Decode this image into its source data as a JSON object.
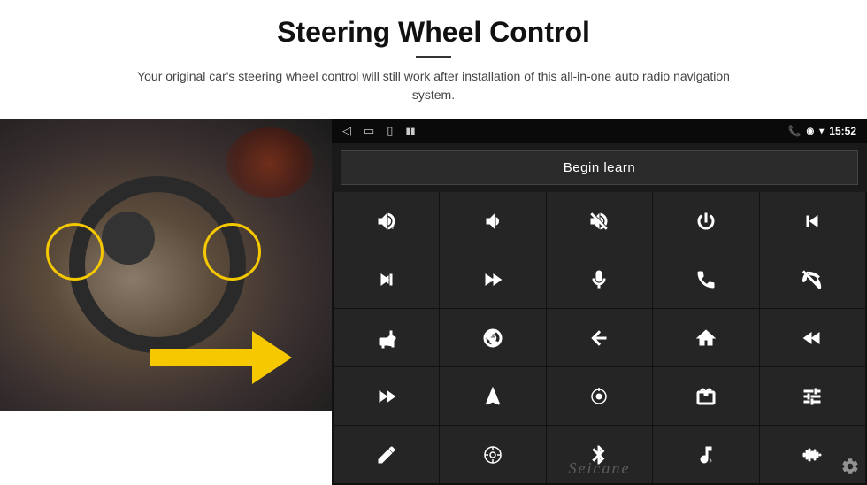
{
  "header": {
    "title": "Steering Wheel Control",
    "divider": true,
    "subtitle": "Your original car's steering wheel control will still work after installation of this all-in-one auto radio navigation system."
  },
  "screen": {
    "status_bar": {
      "time": "15:52",
      "icons_left": [
        "back-arrow",
        "home-square",
        "recent-square",
        "volume-icon"
      ],
      "icons_right": [
        "phone-icon",
        "location-icon",
        "wifi-icon",
        "time"
      ]
    },
    "begin_learn_button": "Begin learn",
    "controls": [
      {
        "icon": "vol-up",
        "symbol": "🔊+"
      },
      {
        "icon": "vol-down",
        "symbol": "🔊−"
      },
      {
        "icon": "mute",
        "symbol": "🔇"
      },
      {
        "icon": "power",
        "symbol": "⏻"
      },
      {
        "icon": "prev-track",
        "symbol": "⏮"
      },
      {
        "icon": "next",
        "symbol": "⏭"
      },
      {
        "icon": "fast-forward-skip",
        "symbol": "⏩"
      },
      {
        "icon": "mic",
        "symbol": "🎤"
      },
      {
        "icon": "phone",
        "symbol": "📞"
      },
      {
        "icon": "hang-up",
        "symbol": "📵"
      },
      {
        "icon": "horn",
        "symbol": "📣"
      },
      {
        "icon": "camera-360",
        "symbol": "📷"
      },
      {
        "icon": "back",
        "symbol": "↩"
      },
      {
        "icon": "home",
        "symbol": "⌂"
      },
      {
        "icon": "rewind",
        "symbol": "⏪"
      },
      {
        "icon": "skip-forward",
        "symbol": "⏭"
      },
      {
        "icon": "nav",
        "symbol": "▶"
      },
      {
        "icon": "source",
        "symbol": "⏺"
      },
      {
        "icon": "radio",
        "symbol": "📻"
      },
      {
        "icon": "eq",
        "symbol": "⚙"
      },
      {
        "icon": "pen",
        "symbol": "✏"
      },
      {
        "icon": "settings-circle",
        "symbol": "⚙"
      },
      {
        "icon": "bluetooth",
        "symbol": "⚡"
      },
      {
        "icon": "music",
        "symbol": "🎵"
      },
      {
        "icon": "waveform",
        "symbol": "📶"
      }
    ],
    "watermark": "Seicane"
  }
}
